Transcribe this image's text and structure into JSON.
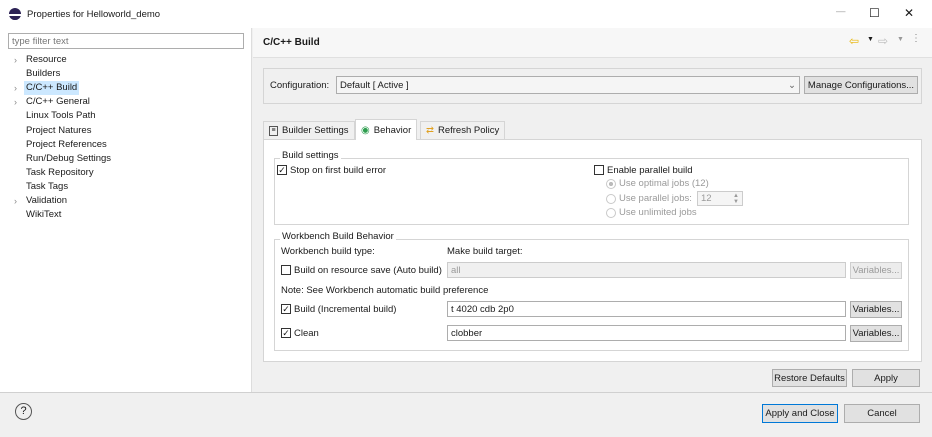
{
  "window": {
    "title": "Properties for Helloworld_demo",
    "minimize": "—",
    "maximize": "☐",
    "close": "✕"
  },
  "filter": {
    "placeholder": "type filter text"
  },
  "tree": [
    {
      "label": "Resource",
      "expandable": true
    },
    {
      "label": "Builders",
      "expandable": false
    },
    {
      "label": "C/C++ Build",
      "expandable": true,
      "selected": true
    },
    {
      "label": "C/C++ General",
      "expandable": true
    },
    {
      "label": "Linux Tools Path",
      "expandable": false
    },
    {
      "label": "Project Natures",
      "expandable": false
    },
    {
      "label": "Project References",
      "expandable": false
    },
    {
      "label": "Run/Debug Settings",
      "expandable": false
    },
    {
      "label": "Task Repository",
      "expandable": false
    },
    {
      "label": "Task Tags",
      "expandable": false
    },
    {
      "label": "Validation",
      "expandable": true
    },
    {
      "label": "WikiText",
      "expandable": false
    }
  ],
  "page": {
    "title": "C/C++ Build"
  },
  "config": {
    "label": "Configuration:",
    "value": "Default  [ Active ]",
    "manage": "Manage Configurations..."
  },
  "tabs": [
    {
      "label": "Builder Settings"
    },
    {
      "label": "Behavior",
      "active": true
    },
    {
      "label": "Refresh Policy"
    }
  ],
  "build_settings": {
    "title": "Build settings",
    "stop_on_error": "Stop on first build error",
    "enable_parallel": "Enable parallel build",
    "optimal": "Use optimal jobs (12)",
    "parallel": "Use parallel jobs:",
    "parallel_value": "12",
    "unlimited": "Use unlimited jobs"
  },
  "workbench": {
    "title": "Workbench Build Behavior",
    "type_label": "Workbench build type:",
    "target_label": "Make build target:",
    "auto_build": "Build on resource save (Auto build)",
    "auto_value": "all",
    "note": "Note: See Workbench automatic build preference",
    "build": "Build (Incremental build)",
    "build_value": "t 4020 cdb 2p0",
    "clean": "Clean",
    "clean_value": "clobber",
    "variables": "Variables..."
  },
  "buttons": {
    "restore": "Restore Defaults",
    "apply": "Apply",
    "apply_close": "Apply and Close",
    "cancel": "Cancel",
    "help": "?"
  }
}
